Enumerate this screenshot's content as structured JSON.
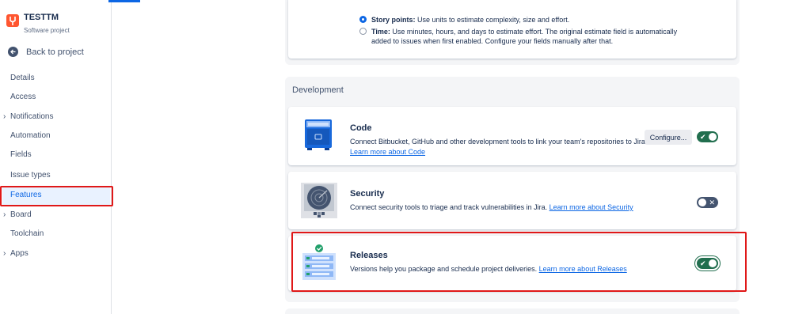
{
  "project": {
    "name": "TESTTM",
    "type": "Software project"
  },
  "back_label": "Back to project",
  "nav": [
    {
      "label": "Details",
      "expandable": false
    },
    {
      "label": "Access",
      "expandable": false
    },
    {
      "label": "Notifications",
      "expandable": true
    },
    {
      "label": "Automation",
      "expandable": false
    },
    {
      "label": "Fields",
      "expandable": false
    },
    {
      "label": "Issue types",
      "expandable": false
    },
    {
      "label": "Features",
      "expandable": false,
      "active": true
    },
    {
      "label": "Board",
      "expandable": true
    },
    {
      "label": "Toolchain",
      "expandable": false
    },
    {
      "label": "Apps",
      "expandable": true
    }
  ],
  "estimation": {
    "story_points": {
      "label": "Story points:",
      "text": " Use units to estimate complexity, size and effort.",
      "selected": true
    },
    "time": {
      "label": "Time:",
      "text": " Use minutes, hours, and days to estimate effort. The original estimate field is automatically",
      "text2": "added to issues when first enabled. Configure your fields manually after that.",
      "selected": false
    }
  },
  "development": {
    "title": "Development",
    "code": {
      "title": "Code",
      "desc": "Connect Bitbucket, GitHub and other development tools to link your team's repositories to Jira.",
      "link": "Learn more about Code",
      "configure_label": "Configure...",
      "enabled": true
    },
    "security": {
      "title": "Security",
      "desc": "Connect security tools to triage and track vulnerabilities in Jira. ",
      "link": "Learn more about Security",
      "enabled": false
    },
    "releases": {
      "title": "Releases",
      "desc": "Versions help you package and schedule project deliveries. ",
      "link": "Learn more about Releases",
      "enabled": true
    }
  },
  "colors": {
    "accent": "#0c66e4",
    "toggle_on": "#216e4e",
    "toggle_off": "#44546f",
    "highlight": "#e01818"
  }
}
